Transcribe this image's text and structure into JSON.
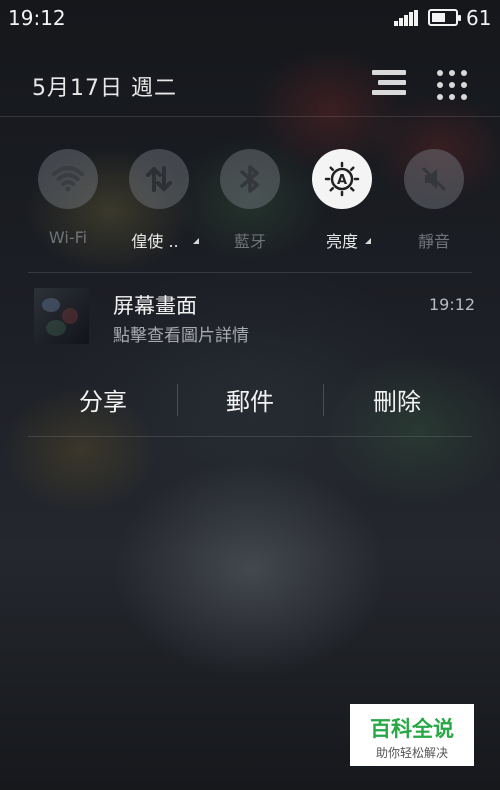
{
  "status_bar": {
    "time": "19:12",
    "battery_level": "61",
    "signal_icon": "signal-bars-icon",
    "battery_icon": "battery-icon"
  },
  "header": {
    "date": "5月17日 週二",
    "list_icon": "list-icon",
    "grid_icon": "grid-icon"
  },
  "quick_toggles": [
    {
      "label": "Wi-Fi",
      "icon": "wifi-icon",
      "active": false,
      "dimmed": true
    },
    {
      "label": "偟使 ..",
      "icon": "mobile-data-icon",
      "active": false,
      "dimmed": false
    },
    {
      "label": "藍牙",
      "icon": "bluetooth-icon",
      "active": false,
      "dimmed": true
    },
    {
      "label": "亮度",
      "icon": "auto-brightness-icon",
      "active": true,
      "dimmed": false
    },
    {
      "label": "靜音",
      "icon": "mute-icon",
      "active": false,
      "dimmed": true
    }
  ],
  "notification": {
    "title": "屏幕畫面",
    "subtitle": "點擊查看圖片詳情",
    "time": "19:12",
    "actions": [
      "分享",
      "郵件",
      "刪除"
    ]
  },
  "watermark": {
    "title": "百科全说",
    "subtitle": "助你轻松解决"
  },
  "colors": {
    "watermark_green": "#27a845",
    "active_toggle": "#f4f4f4"
  }
}
